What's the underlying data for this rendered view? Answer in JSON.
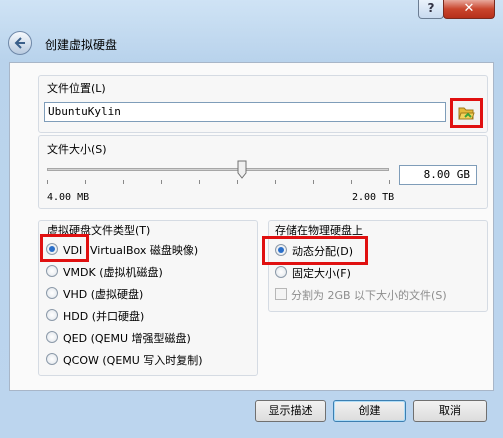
{
  "titlebar": {
    "help_label": "?",
    "close_label": "✕"
  },
  "wizard": {
    "title": "创建虚拟硬盘"
  },
  "location": {
    "group_title": "文件位置(L)",
    "path_value": "UbuntuKylin",
    "folder_icon": "folder-open-icon"
  },
  "size": {
    "group_title": "文件大小(S)",
    "value": "8.00 GB",
    "min_label": "4.00 MB",
    "max_label": "2.00 TB",
    "slider_fraction": 0.57
  },
  "disk_type": {
    "group_title": "虚拟硬盘文件类型(T)",
    "options": [
      {
        "label": "VDI (VirtualBox 磁盘映像)",
        "checked": true
      },
      {
        "label": "VMDK (虚拟机磁盘)",
        "checked": false
      },
      {
        "label": "VHD (虚拟硬盘)",
        "checked": false
      },
      {
        "label": "HDD (并口硬盘)",
        "checked": false
      },
      {
        "label": "QED (QEMU 增强型磁盘)",
        "checked": false
      },
      {
        "label": "QCOW (QEMU 写入时复制)",
        "checked": false
      }
    ]
  },
  "storage": {
    "group_title": "存储在物理硬盘上",
    "options": [
      {
        "label": "动态分配(D)",
        "checked": true
      },
      {
        "label": "固定大小(F)",
        "checked": false
      }
    ],
    "split_label": "分割为 2GB 以下大小的文件(S)",
    "split_checked": false
  },
  "buttons": {
    "describe": "显示描述",
    "create": "创建",
    "cancel": "取消"
  },
  "colors": {
    "accent_blue": "#2a6fc9",
    "highlight_red": "#e01010",
    "close_red": "#c9452d"
  }
}
